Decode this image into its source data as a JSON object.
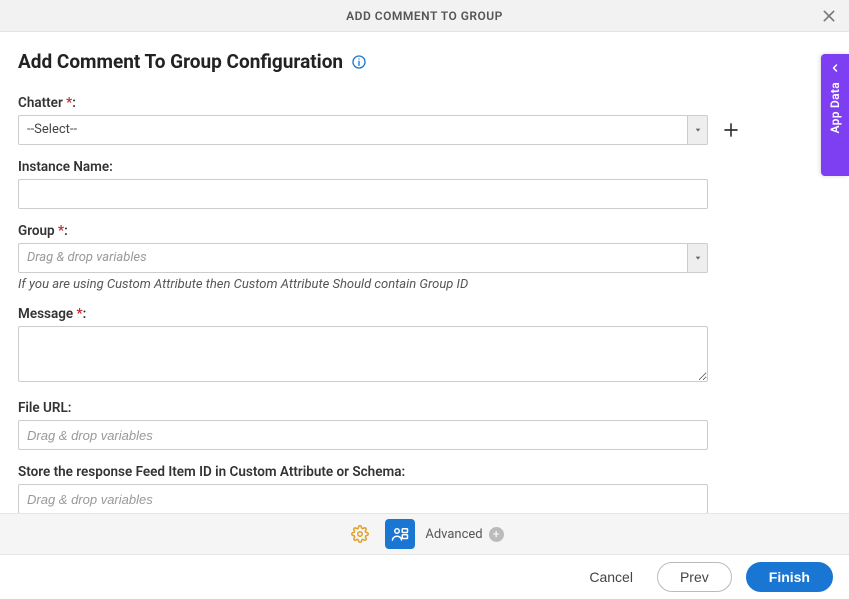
{
  "titlebar": {
    "title": "ADD COMMENT TO GROUP"
  },
  "heading": "Add Comment To Group Configuration",
  "drawer": {
    "label": "App Data"
  },
  "fields": {
    "chatter": {
      "label": "Chatter",
      "required": "*",
      "selected": "--Select--"
    },
    "instance_name": {
      "label": "Instance Name:",
      "value": ""
    },
    "group": {
      "label": "Group",
      "required": "*",
      "placeholder": "Drag & drop variables",
      "hint": "If you are using Custom Attribute then Custom Attribute Should contain Group ID"
    },
    "message": {
      "label": "Message",
      "required": "*",
      "value": ""
    },
    "file_url": {
      "label": "File URL:",
      "placeholder": "Drag & drop variables"
    },
    "store_response": {
      "label": "Store the response Feed Item ID in Custom Attribute or Schema:",
      "placeholder": "Drag & drop variables"
    }
  },
  "toolbar": {
    "advanced_label": "Advanced"
  },
  "footer": {
    "cancel": "Cancel",
    "prev": "Prev",
    "finish": "Finish"
  }
}
